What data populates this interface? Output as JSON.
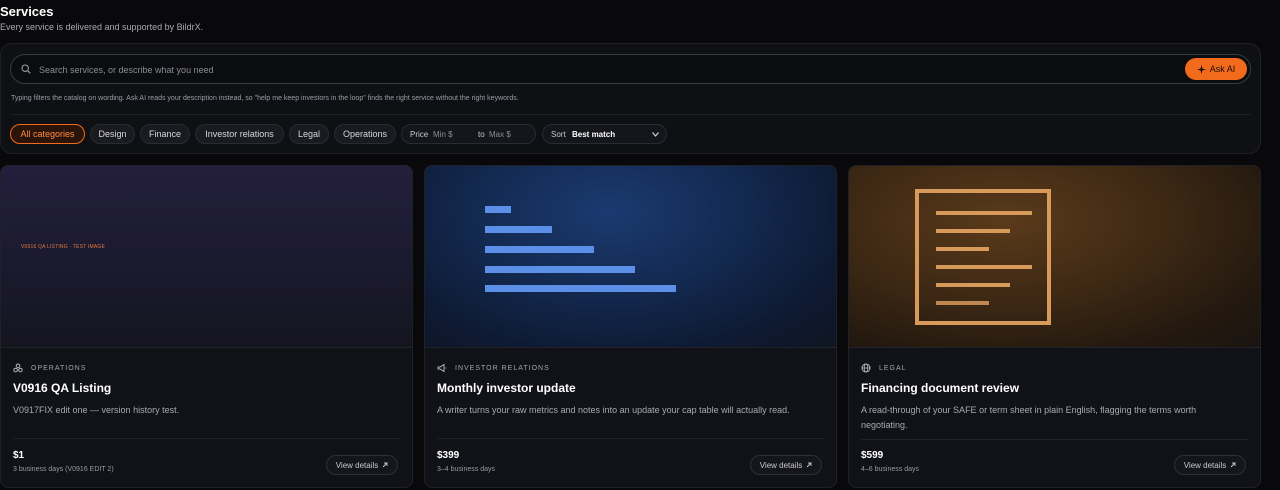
{
  "header": {
    "title": "Services",
    "subtitle": "Every service is delivered and supported by BildrX."
  },
  "search": {
    "placeholder": "Search services, or describe what you need",
    "ask_label": "Ask AI",
    "hint": "Typing filters the catalog on wording. Ask AI reads your description instead, so \"help me keep investors in the loop\" finds the right service without the right keywords."
  },
  "filters": {
    "chips": [
      "All categories",
      "Design",
      "Finance",
      "Investor relations",
      "Legal",
      "Operations"
    ],
    "active_chip": "All categories",
    "price_label": "Price",
    "min_placeholder": "Min $",
    "to_label": "to",
    "max_placeholder": "Max $",
    "sort_label": "Sort",
    "sort_value": "Best match"
  },
  "cards": [
    {
      "category": "OPERATIONS",
      "category_icon": "operations-icon",
      "hero_text": "V0916 QA LISTING · TEST IMAGE",
      "title": "V0916 QA Listing",
      "description": "V0917FIX edit one — version history test.",
      "price": "$1",
      "days": "3 business days (V0916 EDIT 2)",
      "button": "View details"
    },
    {
      "category": "INVESTOR RELATIONS",
      "category_icon": "megaphone-icon",
      "title": "Monthly investor update",
      "description": "A writer turns your raw metrics and notes into an update your cap table will actually read.",
      "price": "$399",
      "days": "3–4 business days",
      "button": "View details"
    },
    {
      "category": "LEGAL",
      "category_icon": "globe-icon",
      "title": "Financing document review",
      "description": "A read-through of your SAFE or term sheet in plain English, flagging the terms worth negotiating.",
      "price": "$599",
      "days": "4–6 business days",
      "button": "View details"
    }
  ],
  "colors": {
    "accent": "#f26a1b",
    "background": "#09090c"
  }
}
